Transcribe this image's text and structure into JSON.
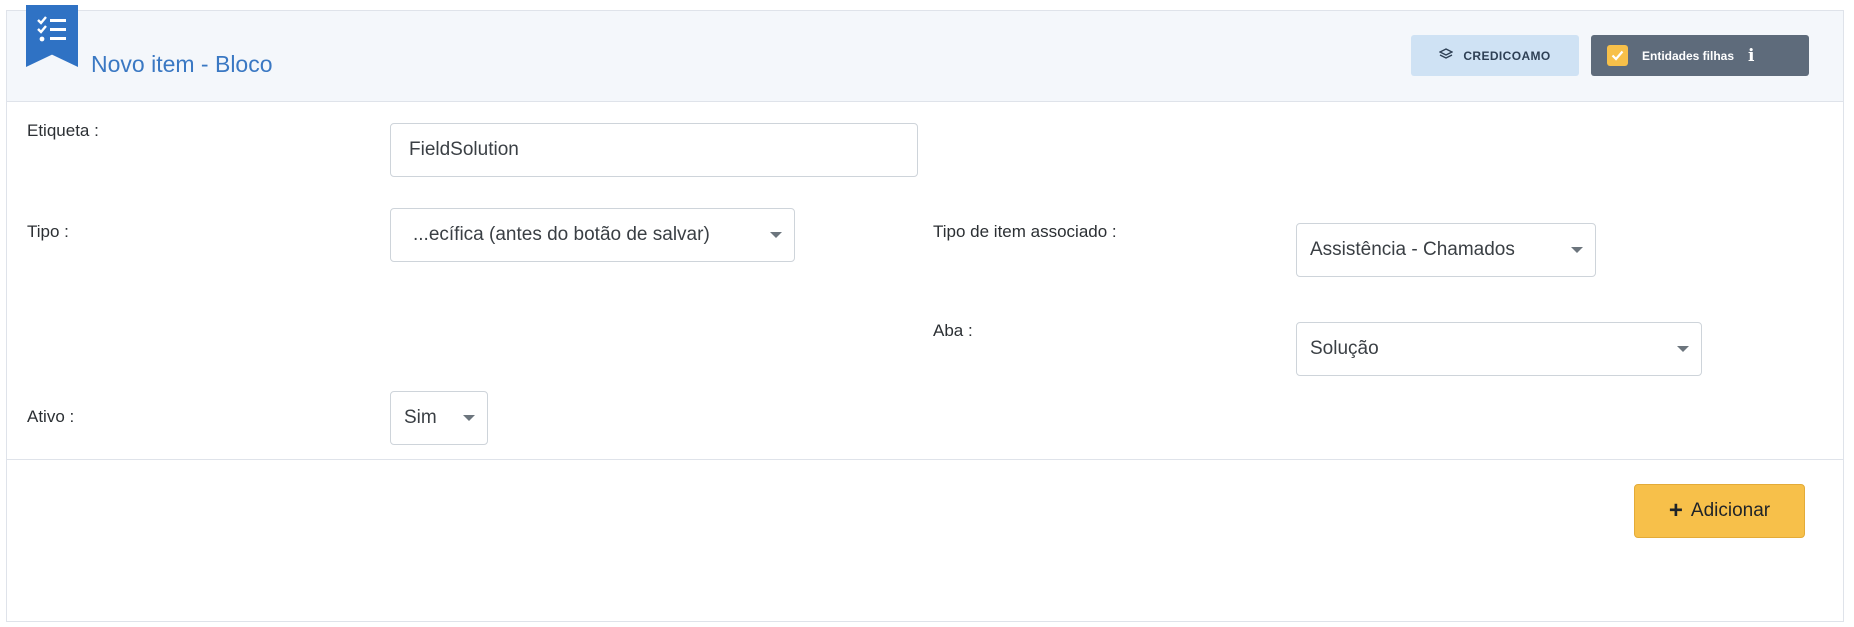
{
  "header": {
    "title": "Novo item - Bloco",
    "entity_badge": "CREDICOAMO",
    "child_entities": {
      "label": "Entidades filhas",
      "checked": true
    },
    "icons": {
      "ribbon": "checklist-icon",
      "entity": "layers-icon",
      "info": "info-icon"
    }
  },
  "form": {
    "label_field": {
      "label": "Etiqueta :",
      "value": "FieldSolution"
    },
    "type": {
      "label": "Tipo :",
      "value": "...ecífica (antes do botão de salvar)"
    },
    "associated_item_type": {
      "label": "Tipo de item associado :",
      "value": "Assistência - Chamados"
    },
    "tab": {
      "label": "Aba :",
      "value": "Solução"
    },
    "active": {
      "label": "Ativo :",
      "value": "Sim"
    }
  },
  "actions": {
    "add_label": "Adicionar"
  },
  "colors": {
    "accent": "#2f72c4",
    "title": "#3a78c3",
    "add_button": "#f7c04a",
    "entity_badge_bg": "#cfe2f4",
    "child_badge_bg": "#5e6b7b"
  }
}
